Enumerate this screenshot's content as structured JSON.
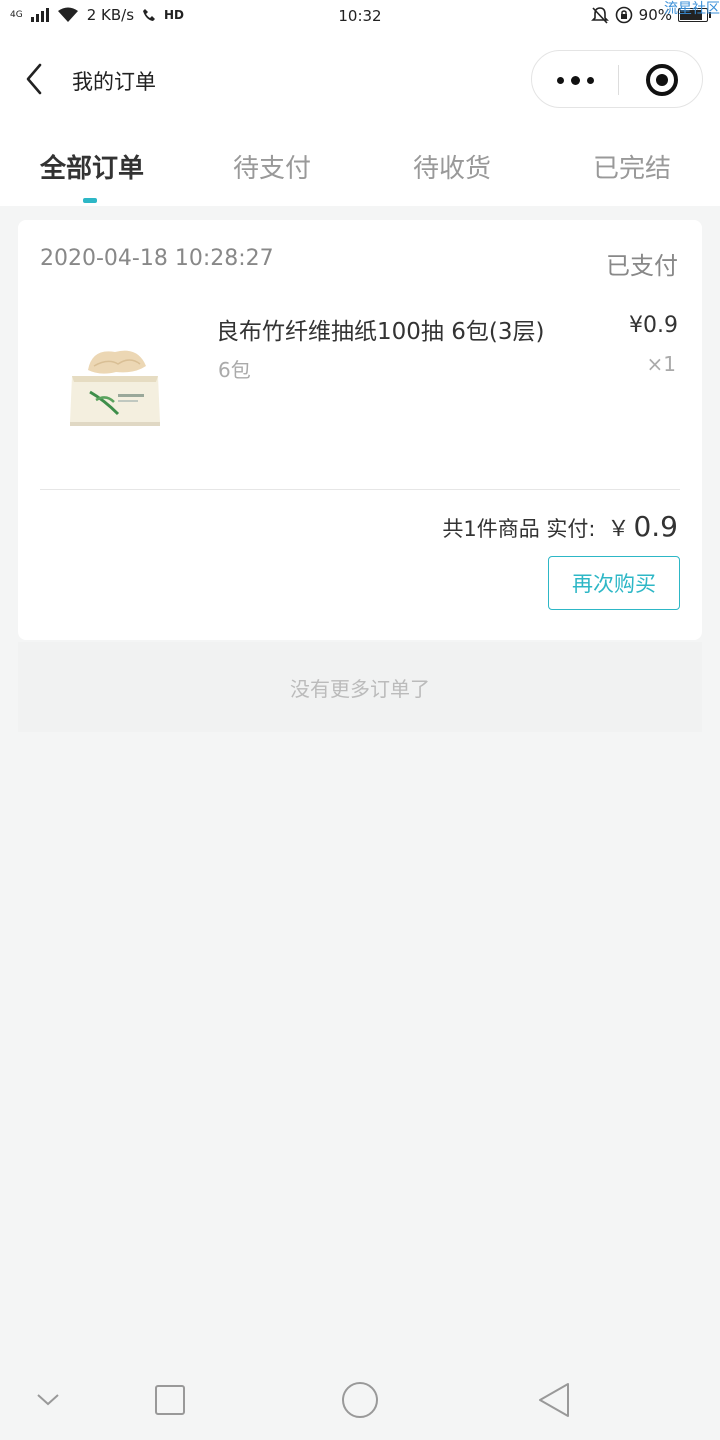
{
  "status_bar": {
    "network": "4G",
    "speed": "2 KB/s",
    "hd": "HD",
    "time": "10:32",
    "battery": "90%",
    "battery_level": 0.9,
    "watermark": "流星社区"
  },
  "header": {
    "title": "我的订单"
  },
  "tabs": [
    {
      "label": "全部订单",
      "active": true
    },
    {
      "label": "待支付",
      "active": false
    },
    {
      "label": "待收货",
      "active": false
    },
    {
      "label": "已完结",
      "active": false
    }
  ],
  "order": {
    "date": "2020-04-18 10:28:27",
    "status": "已支付",
    "item": {
      "name": "良布竹纤维抽纸100抽 6包(3层)",
      "spec": "6包",
      "price": "¥0.9",
      "qty": "×1",
      "image_icon": "tissue-box-image"
    },
    "summary_label": "共1件商品 实付:",
    "currency": "￥",
    "total": "0.9",
    "rebuy_label": "再次购买"
  },
  "footer_note": "没有更多订单了",
  "colors": {
    "accent": "#2db7c6",
    "background": "#f4f5f5"
  }
}
